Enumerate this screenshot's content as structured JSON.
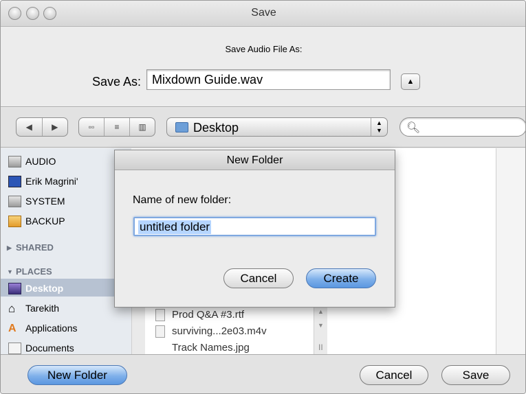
{
  "window": {
    "title": "Save"
  },
  "prompt": "Save Audio File As:",
  "save_as": {
    "label": "Save As:",
    "value": "Mixdown Guide.wav",
    "expand_glyph": "▲"
  },
  "toolbar": {
    "back_glyph": "◀",
    "forward_glyph": "▶",
    "view_icon_glyph": "▫▫",
    "view_list_glyph": "≡",
    "view_column_glyph": "▥",
    "location": "Desktop",
    "search_value": ""
  },
  "sidebar": {
    "devices": [
      {
        "label": "AUDIO",
        "icon": "hard-drive-icon"
      },
      {
        "label": "Erik Magrini'",
        "icon": "computer-icon"
      },
      {
        "label": "SYSTEM",
        "icon": "hard-drive-icon"
      },
      {
        "label": "BACKUP",
        "icon": "backup-drive-icon"
      }
    ],
    "shared_header": "SHARED",
    "places_header": "PLACES",
    "places": [
      {
        "label": "Desktop",
        "icon": "desktop-icon",
        "selected": true
      },
      {
        "label": "Tarekith",
        "icon": "home-icon"
      },
      {
        "label": "Applications",
        "icon": "applications-icon"
      },
      {
        "label": "Documents",
        "icon": "documents-icon"
      }
    ]
  },
  "files": [
    {
      "label": "Prod Q&A #3.rtf"
    },
    {
      "label": "surviving...2e03.m4v"
    },
    {
      "label": "Track Names.jpg"
    }
  ],
  "sheet": {
    "title": "New Folder",
    "label": "Name of new folder:",
    "value": "untitled folder",
    "cancel": "Cancel",
    "create": "Create"
  },
  "footer": {
    "new_folder": "New Folder",
    "cancel": "Cancel",
    "save": "Save"
  },
  "colors": {
    "accent": "#5a97e0",
    "selection": "#b7c2d2",
    "sidebar_bg": "#e7ebf0"
  }
}
